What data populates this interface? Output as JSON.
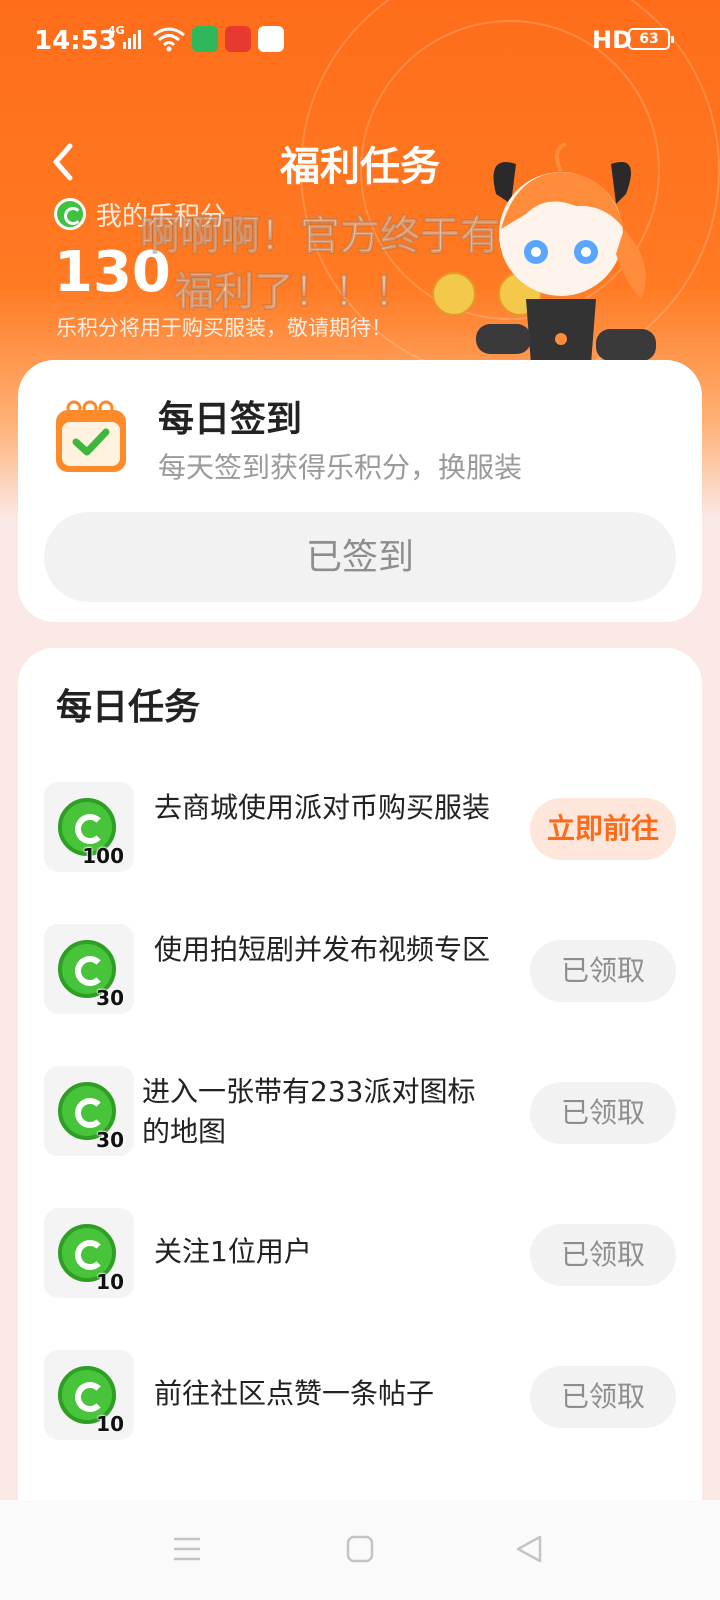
{
  "status_bar": {
    "time": "14:53",
    "network": "4G",
    "hd": "HD",
    "battery": "63"
  },
  "header": {
    "title": "福利任务",
    "points_label": "我的乐积分",
    "points_value": "130",
    "points_note": "乐积分将用于购买服装，敬请期待！"
  },
  "overlay": {
    "line1": "啊啊啊！官方终于有这种",
    "line2": "福利了！！！"
  },
  "signin": {
    "title": "每日签到",
    "subtitle": "每天签到获得乐积分，换服装",
    "button": "已签到"
  },
  "tasks": {
    "title": "每日任务",
    "items": [
      {
        "reward": "100",
        "label": "去商城使用派对币购买服装",
        "action": "立即前往"
      },
      {
        "reward": "30",
        "label": "使用拍短剧并发布视频专区",
        "action": "已领取"
      },
      {
        "reward": "30",
        "label": "进入一张带有233派对图标的地图",
        "action": "已领取"
      },
      {
        "reward": "10",
        "label": "关注1位用户",
        "action": "已领取"
      },
      {
        "reward": "10",
        "label": "前往社区点赞一条帖子",
        "action": "已领取"
      }
    ]
  },
  "colors": {
    "accent": "#ff6a1a",
    "coin_green": "#48c43a"
  }
}
